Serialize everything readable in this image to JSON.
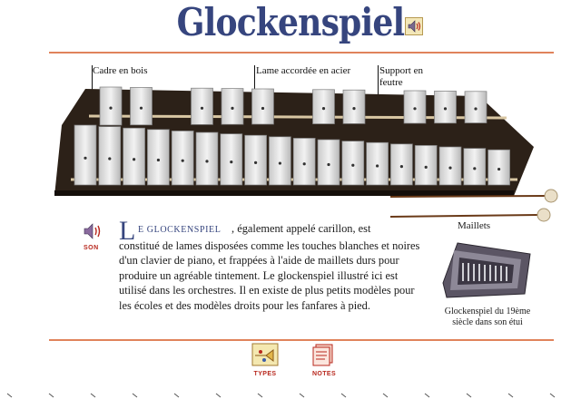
{
  "title": "Glockenspiel",
  "callouts": {
    "frame": "Cadre en bois",
    "bar": "Lame accordée en acier",
    "support_line1": "Support en",
    "support_line2": "feutre"
  },
  "sound": {
    "label": "SON",
    "icon": "speaker-icon"
  },
  "article": {
    "dropcap": "L",
    "lead": "E GLOCKENSPIEL",
    "line1_rest": ", également appelé carillon, est",
    "rest": "constitué de lames disposées comme les touches blanches et noires d'un clavier de piano, et frappées à l'aide de maillets durs pour produire un agréable tintement. Le glockenspiel illustré ici est utilisé dans les orchestres. Il en existe de plus petits modèles pour les écoles et des modèles droits pour les fanfares à pied."
  },
  "mallets_label": "Maillets",
  "case_caption": "Glockenspiel du 19ème siècle dans son étui",
  "nav": {
    "types": {
      "label": "TYPES",
      "icon": "trumpet-icon"
    },
    "notes": {
      "label": "NOTES",
      "icon": "notes-icon"
    }
  },
  "colors": {
    "title": "#36457e",
    "rule": "#e0835b",
    "nav_label": "#b8281e"
  }
}
